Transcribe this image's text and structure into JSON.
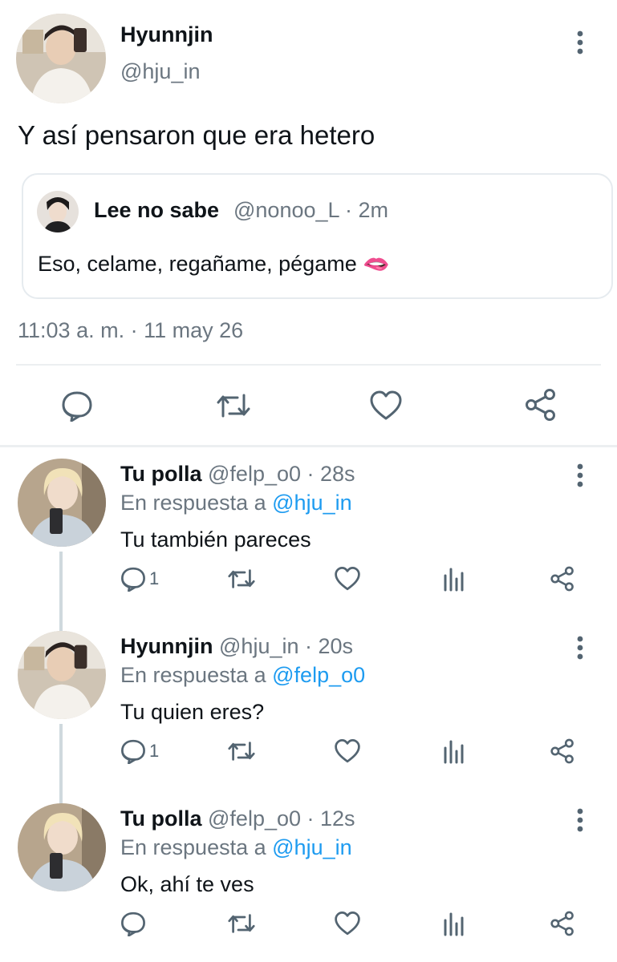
{
  "main_tweet": {
    "author_name": "Hyunnjin",
    "author_handle": "@hju_in",
    "text": "Y así pensaron que era hetero",
    "quoted": {
      "author_name": "Lee no sabe",
      "meta": "@nonoo_L · 2m",
      "text": "Eso, celame, regañame, pégame 🫦"
    },
    "timestamp": "11:03 a. m. · 11 may 26",
    "actions": [
      "reply-icon",
      "retweet-icon",
      "like-icon",
      "share-icon"
    ]
  },
  "replies": [
    {
      "author_name": "Tu polla",
      "meta": "@felp_o0 · 28s",
      "replying_prefix": "En respuesta a",
      "replying_to": "@hju_in",
      "text": "Tu también pareces",
      "reply_count": "1"
    },
    {
      "author_name": "Hyunnjin",
      "meta": "@hju_in · 20s",
      "replying_prefix": "En respuesta a",
      "replying_to": "@felp_o0",
      "text": "Tu quien eres?",
      "reply_count": "1"
    },
    {
      "author_name": "Tu polla",
      "meta": "@felp_o0 · 12s",
      "replying_prefix": "En respuesta a",
      "replying_to": "@hju_in",
      "text": "Ok, ahí te ves",
      "reply_count": ""
    }
  ],
  "colors": {
    "link": "#1d9bf0",
    "icon": "#536471",
    "text": "#0f1419",
    "muted": "#6b7680",
    "divider": "#eceff1"
  }
}
